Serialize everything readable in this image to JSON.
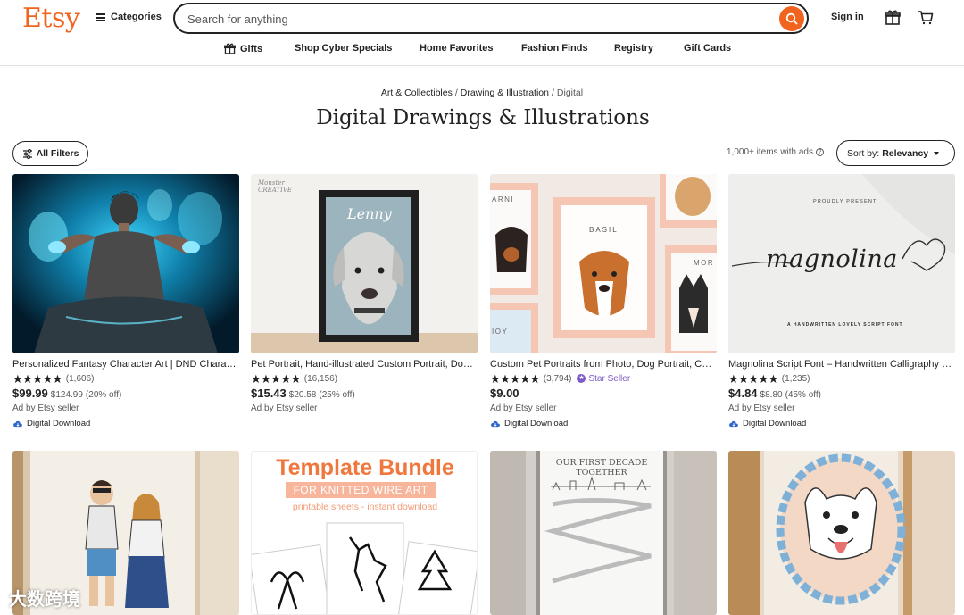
{
  "brand": {
    "logo": "Etsy",
    "accent": "#f1641e"
  },
  "header": {
    "categories_label": "Categories",
    "search_placeholder": "Search for anything",
    "signin_label": "Sign in"
  },
  "nav": [
    {
      "label": "Gifts",
      "icon": "gift-icon"
    },
    {
      "label": "Shop Cyber Specials"
    },
    {
      "label": "Home Favorites"
    },
    {
      "label": "Fashion Finds"
    },
    {
      "label": "Registry"
    },
    {
      "label": "Gift Cards"
    }
  ],
  "breadcrumb": [
    "Art & Collectibles",
    "Drawing & Illustration",
    "Digital"
  ],
  "page_title": "Digital Drawings & Illustrations",
  "toolbar": {
    "filters_label": "All Filters",
    "items_count": "1,000+ items with ads",
    "sort_prefix": "Sort by:",
    "sort_value": "Relevancy"
  },
  "listings": [
    {
      "title": "Personalized Fantasy Character Art | DND Character Commission",
      "stars": "★★★★★",
      "reviews": "(1,606)",
      "price": "$99.99",
      "original_price": "$124.99",
      "discount": "(20% off)",
      "ad": "Ad by Etsy seller",
      "badge": "Digital Download"
    },
    {
      "title": "Pet Portrait, Hand-illustrated Custom Portrait, Dog Portrait",
      "stars": "★★★★★",
      "reviews": "(16,156)",
      "price": "$15.43",
      "original_price": "$20.58",
      "discount": "(25% off)",
      "ad": "Ad by Etsy seller"
    },
    {
      "title": "Custom Pet Portraits from Photo, Dog Portrait, Cat Portrait",
      "stars": "★★★★★",
      "reviews": "(3,794)",
      "star_seller": "Star Seller",
      "price": "$9.00",
      "ad": "Ad by Etsy seller",
      "badge": "Digital Download"
    },
    {
      "title": "Magnolina Script Font – Handwritten Calligraphy Font",
      "stars": "★★★★★",
      "reviews": "(1,235)",
      "price": "$4.84",
      "original_price": "$8.80",
      "discount": "(45% off)",
      "ad": "Ad by Etsy seller",
      "badge": "Digital Download"
    }
  ],
  "images": {
    "pet_portrait_sign": "Monster CREATIVE",
    "pet_name": "Lenny",
    "basil": "BASIL",
    "arni": "ARNI",
    "mor": "MOR",
    "ioy": "IOY",
    "magnolina_top": "PROUDLY PRESENT",
    "magnolina_text": "magnolina",
    "magnolina_sub": "A HANDWRITTEN LOVELY SCRIPT FONT",
    "bundle_title": "Template Bundle",
    "bundle_sub": "FOR KNITTED WIRE ART",
    "bundle_sub2": "printable sheets - instant download",
    "decade": "OUR FIRST DECADE TOGETHER"
  },
  "watermark": "大数跨境"
}
